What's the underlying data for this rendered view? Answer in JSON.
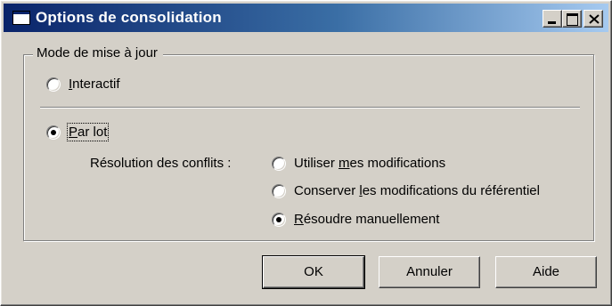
{
  "window": {
    "title": "Options de consolidation"
  },
  "group": {
    "legend": "Mode de mise à jour"
  },
  "options": {
    "interactif": {
      "prefix": "",
      "accel": "I",
      "suffix": "nteractif",
      "checked": false
    },
    "par_lot": {
      "prefix": "",
      "accel": "P",
      "suffix": "ar lot",
      "checked": true
    }
  },
  "conflicts": {
    "label": "Résolution des conflits :",
    "items": [
      {
        "prefix": "Utiliser ",
        "accel": "m",
        "suffix": "es modifications",
        "checked": false
      },
      {
        "prefix": "Conserver ",
        "accel": "l",
        "suffix": "es modifications du référentiel",
        "checked": false
      },
      {
        "prefix": "",
        "accel": "R",
        "suffix": "ésoudre manuellement",
        "checked": true
      }
    ]
  },
  "buttons": {
    "ok": "OK",
    "cancel": "Annuler",
    "help": "Aide"
  }
}
